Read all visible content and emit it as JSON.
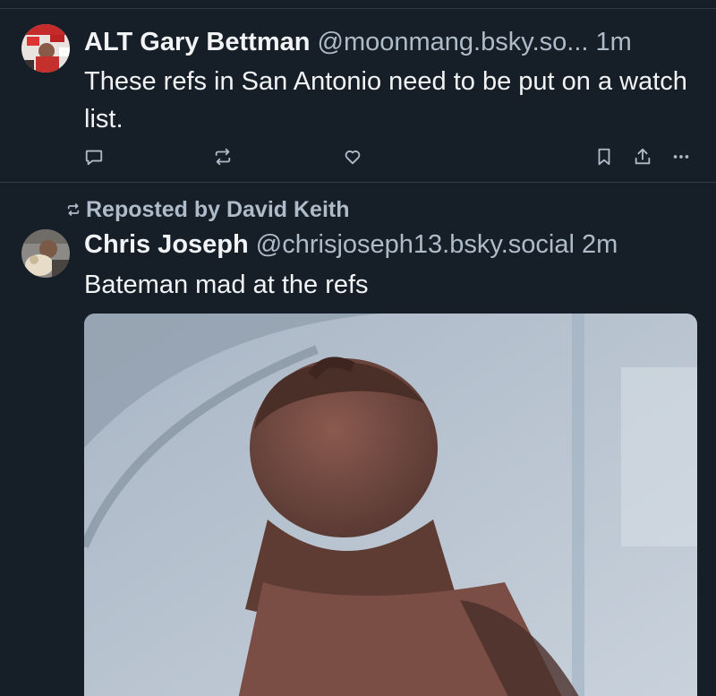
{
  "posts": [
    {
      "display_name": "ALT Gary Bettman",
      "handle": "@moonmang.bsky.so...",
      "time": "1m",
      "text": "These refs in San Antonio need to be put on a watch list."
    },
    {
      "reposted_by": "Reposted by David Keith",
      "display_name": "Chris Joseph",
      "handle": "@chrisjoseph13.bsky.social",
      "time": "2m",
      "text": "Bateman mad at the refs"
    }
  ],
  "icons": {
    "reply": "reply-icon",
    "repost": "repost-icon",
    "like": "heart-icon",
    "bookmark": "bookmark-icon",
    "share": "share-icon",
    "more": "more-icon"
  },
  "colors": {
    "background": "#161e27",
    "text": "#f1f3f5",
    "secondary_text": "#aebbc9",
    "divider": "#2e3a48"
  }
}
